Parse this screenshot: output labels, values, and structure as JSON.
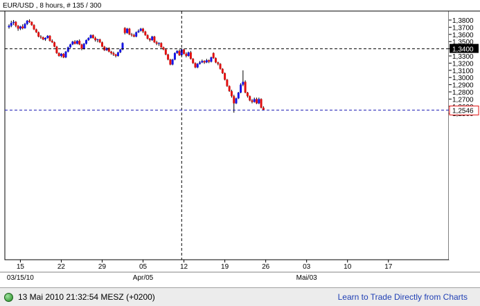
{
  "header": {
    "title": "EUR/USD , 8 hours, # 135 / 300"
  },
  "status_bar": {
    "timestamp": "13 Mai 2010 21:32:54  MESZ (+0200)",
    "link_label": "Learn to Trade Directly from Charts",
    "indicator_color": "#2e9e2e"
  },
  "colors": {
    "up": "#1515e6",
    "down": "#e01010",
    "crosshair": "#000000",
    "last_line": "#1a1ab4",
    "last_box": "#e01010"
  },
  "chart_data": {
    "type": "candlestick",
    "title": "EUR/USD , 8 hours, # 135 / 300",
    "ylim": [
      1.25,
      1.385
    ],
    "y_ticks": [
      "1,3800",
      "1,3700",
      "1,3600",
      "1,3500",
      "1,3400",
      "1,3300",
      "1,3200",
      "1,3100",
      "1,3000",
      "1,2900",
      "1,2800",
      "1,2700",
      "1,2600",
      "1,2500"
    ],
    "x_ticks": [
      {
        "label": "15",
        "bar": 5
      },
      {
        "label": "22",
        "bar": 23
      },
      {
        "label": "29",
        "bar": 41
      },
      {
        "label": "05",
        "bar": 59
      },
      {
        "label": "12",
        "bar": 77
      },
      {
        "label": "19",
        "bar": 95
      },
      {
        "label": "26",
        "bar": 113
      },
      {
        "label": "03",
        "bar": 131
      },
      {
        "label": "10",
        "bar": 149
      },
      {
        "label": "17",
        "bar": 167
      }
    ],
    "month_labels": [
      {
        "label": "03/15/10",
        "bar": 5
      },
      {
        "label": "Apr/05",
        "bar": 59
      },
      {
        "label": "Mai/03",
        "bar": 131
      }
    ],
    "crosshair": {
      "bar": 76,
      "price": 1.34,
      "price_label": "1,3400"
    },
    "last_price": {
      "value": 1.2546,
      "label": "1,2546"
    },
    "candles": [
      [
        1.37,
        1.374,
        1.368,
        1.372
      ],
      [
        1.372,
        1.379,
        1.37,
        1.376
      ],
      [
        1.376,
        1.38,
        1.373,
        1.3775
      ],
      [
        1.3775,
        1.3785,
        1.37,
        1.372
      ],
      [
        1.372,
        1.373,
        1.365,
        1.368
      ],
      [
        1.368,
        1.372,
        1.366,
        1.371
      ],
      [
        1.371,
        1.374,
        1.367,
        1.3685
      ],
      [
        1.3685,
        1.376,
        1.368,
        1.3745
      ],
      [
        1.3745,
        1.38,
        1.373,
        1.379
      ],
      [
        1.379,
        1.381,
        1.376,
        1.3775
      ],
      [
        1.3775,
        1.378,
        1.372,
        1.373
      ],
      [
        1.373,
        1.374,
        1.366,
        1.367
      ],
      [
        1.367,
        1.368,
        1.362,
        1.363
      ],
      [
        1.363,
        1.364,
        1.356,
        1.357
      ],
      [
        1.357,
        1.359,
        1.354,
        1.356
      ],
      [
        1.356,
        1.357,
        1.352,
        1.353
      ],
      [
        1.353,
        1.356,
        1.351,
        1.355
      ],
      [
        1.355,
        1.359,
        1.354,
        1.358
      ],
      [
        1.358,
        1.359,
        1.35,
        1.351
      ],
      [
        1.351,
        1.353,
        1.348,
        1.349
      ],
      [
        1.349,
        1.35,
        1.342,
        1.343
      ],
      [
        1.343,
        1.344,
        1.333,
        1.334
      ],
      [
        1.334,
        1.335,
        1.329,
        1.33
      ],
      [
        1.33,
        1.334,
        1.328,
        1.333
      ],
      [
        1.333,
        1.334,
        1.327,
        1.328
      ],
      [
        1.328,
        1.337,
        1.327,
        1.336
      ],
      [
        1.336,
        1.343,
        1.335,
        1.342
      ],
      [
        1.342,
        1.347,
        1.341,
        1.346
      ],
      [
        1.346,
        1.351,
        1.345,
        1.35
      ],
      [
        1.35,
        1.352,
        1.346,
        1.347
      ],
      [
        1.347,
        1.352,
        1.346,
        1.351
      ],
      [
        1.351,
        1.353,
        1.345,
        1.346
      ],
      [
        1.346,
        1.347,
        1.338,
        1.34
      ],
      [
        1.34,
        1.348,
        1.339,
        1.347
      ],
      [
        1.347,
        1.353,
        1.346,
        1.352
      ],
      [
        1.352,
        1.356,
        1.351,
        1.355
      ],
      [
        1.355,
        1.36,
        1.354,
        1.359
      ],
      [
        1.359,
        1.36,
        1.354,
        1.355
      ],
      [
        1.355,
        1.357,
        1.35,
        1.352
      ],
      [
        1.352,
        1.354,
        1.349,
        1.353
      ],
      [
        1.353,
        1.354,
        1.348,
        1.349
      ],
      [
        1.349,
        1.35,
        1.342,
        1.343
      ],
      [
        1.343,
        1.344,
        1.337,
        1.338
      ],
      [
        1.338,
        1.342,
        1.337,
        1.341
      ],
      [
        1.341,
        1.342,
        1.335,
        1.336
      ],
      [
        1.336,
        1.337,
        1.332,
        1.334
      ],
      [
        1.334,
        1.336,
        1.33,
        1.332
      ],
      [
        1.332,
        1.333,
        1.328,
        1.33
      ],
      [
        1.33,
        1.336,
        1.329,
        1.335
      ],
      [
        1.335,
        1.34,
        1.334,
        1.339
      ],
      [
        1.339,
        1.349,
        1.338,
        1.348
      ],
      [
        1.369,
        1.37,
        1.36,
        1.362
      ],
      [
        1.362,
        1.369,
        1.361,
        1.368
      ],
      [
        1.368,
        1.369,
        1.359,
        1.36
      ],
      [
        1.36,
        1.362,
        1.357,
        1.359
      ],
      [
        1.359,
        1.361,
        1.356,
        1.357
      ],
      [
        1.357,
        1.364,
        1.356,
        1.363
      ],
      [
        1.363,
        1.367,
        1.362,
        1.365
      ],
      [
        1.365,
        1.369,
        1.364,
        1.368
      ],
      [
        1.368,
        1.369,
        1.362,
        1.364
      ],
      [
        1.364,
        1.365,
        1.358,
        1.359
      ],
      [
        1.359,
        1.36,
        1.353,
        1.354
      ],
      [
        1.354,
        1.355,
        1.35,
        1.352
      ],
      [
        1.352,
        1.358,
        1.351,
        1.357
      ],
      [
        1.357,
        1.358,
        1.348,
        1.349
      ],
      [
        1.349,
        1.351,
        1.345,
        1.347
      ],
      [
        1.347,
        1.349,
        1.344,
        1.348
      ],
      [
        1.348,
        1.349,
        1.341,
        1.342
      ],
      [
        1.342,
        1.343,
        1.338,
        1.339
      ],
      [
        1.339,
        1.34,
        1.331,
        1.332
      ],
      [
        1.332,
        1.333,
        1.324,
        1.325
      ],
      [
        1.325,
        1.326,
        1.317,
        1.318
      ],
      [
        1.318,
        1.326,
        1.317,
        1.325
      ],
      [
        1.325,
        1.335,
        1.324,
        1.334
      ],
      [
        1.334,
        1.338,
        1.333,
        1.337
      ],
      [
        1.337,
        1.339,
        1.33,
        1.331
      ],
      [
        1.331,
        1.34,
        1.33,
        1.339
      ],
      [
        1.339,
        1.34,
        1.332,
        1.333
      ],
      [
        1.333,
        1.335,
        1.328,
        1.33
      ],
      [
        1.33,
        1.336,
        1.329,
        1.335
      ],
      [
        1.335,
        1.337,
        1.325,
        1.326
      ],
      [
        1.326,
        1.327,
        1.319,
        1.32
      ],
      [
        1.32,
        1.321,
        1.313,
        1.314
      ],
      [
        1.314,
        1.32,
        1.313,
        1.319
      ],
      [
        1.319,
        1.323,
        1.318,
        1.321
      ],
      [
        1.321,
        1.325,
        1.32,
        1.323
      ],
      [
        1.323,
        1.324,
        1.319,
        1.321
      ],
      [
        1.321,
        1.326,
        1.32,
        1.324
      ],
      [
        1.324,
        1.325,
        1.32,
        1.322
      ],
      [
        1.322,
        1.329,
        1.321,
        1.328
      ],
      [
        1.334,
        1.335,
        1.326,
        1.327
      ],
      [
        1.327,
        1.328,
        1.32,
        1.321
      ],
      [
        1.321,
        1.322,
        1.317,
        1.319
      ],
      [
        1.319,
        1.32,
        1.311,
        1.312
      ],
      [
        1.312,
        1.313,
        1.305,
        1.306
      ],
      [
        1.306,
        1.307,
        1.296,
        1.297
      ],
      [
        1.297,
        1.298,
        1.287,
        1.288
      ],
      [
        1.288,
        1.289,
        1.28,
        1.281
      ],
      [
        1.281,
        1.283,
        1.272,
        1.274
      ],
      [
        1.274,
        1.276,
        1.251,
        1.264
      ],
      [
        1.264,
        1.272,
        1.263,
        1.271
      ],
      [
        1.271,
        1.28,
        1.27,
        1.279
      ],
      [
        1.279,
        1.292,
        1.278,
        1.29
      ],
      [
        1.29,
        1.31,
        1.288,
        1.294
      ],
      [
        1.294,
        1.296,
        1.278,
        1.279
      ],
      [
        1.279,
        1.28,
        1.272,
        1.274
      ],
      [
        1.274,
        1.275,
        1.267,
        1.268
      ],
      [
        1.268,
        1.27,
        1.264,
        1.266
      ],
      [
        1.266,
        1.272,
        1.265,
        1.27
      ],
      [
        1.27,
        1.272,
        1.263,
        1.264
      ],
      [
        1.264,
        1.272,
        1.263,
        1.27
      ],
      [
        1.27,
        1.271,
        1.257,
        1.258
      ],
      [
        1.258,
        1.26,
        1.254,
        1.2546
      ]
    ]
  }
}
